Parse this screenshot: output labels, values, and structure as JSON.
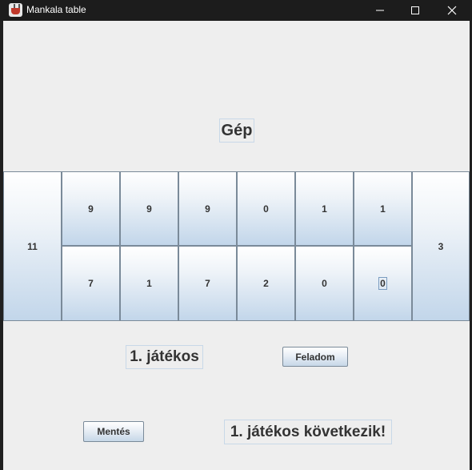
{
  "window": {
    "title": "Mankala table",
    "minimize_icon": "minimize-icon",
    "maximize_icon": "maximize-icon",
    "close_icon": "close-icon"
  },
  "board": {
    "opponent_label": "Gép",
    "left_store": "11",
    "right_store": "3",
    "top_row": [
      "9",
      "9",
      "9",
      "0",
      "1",
      "1"
    ],
    "bottom_row": [
      "7",
      "1",
      "7",
      "2",
      "0",
      "0"
    ]
  },
  "player_label": "1. játékos",
  "buttons": {
    "give_up": "Feladom",
    "save": "Mentés"
  },
  "status": "1. játékos következik!"
}
